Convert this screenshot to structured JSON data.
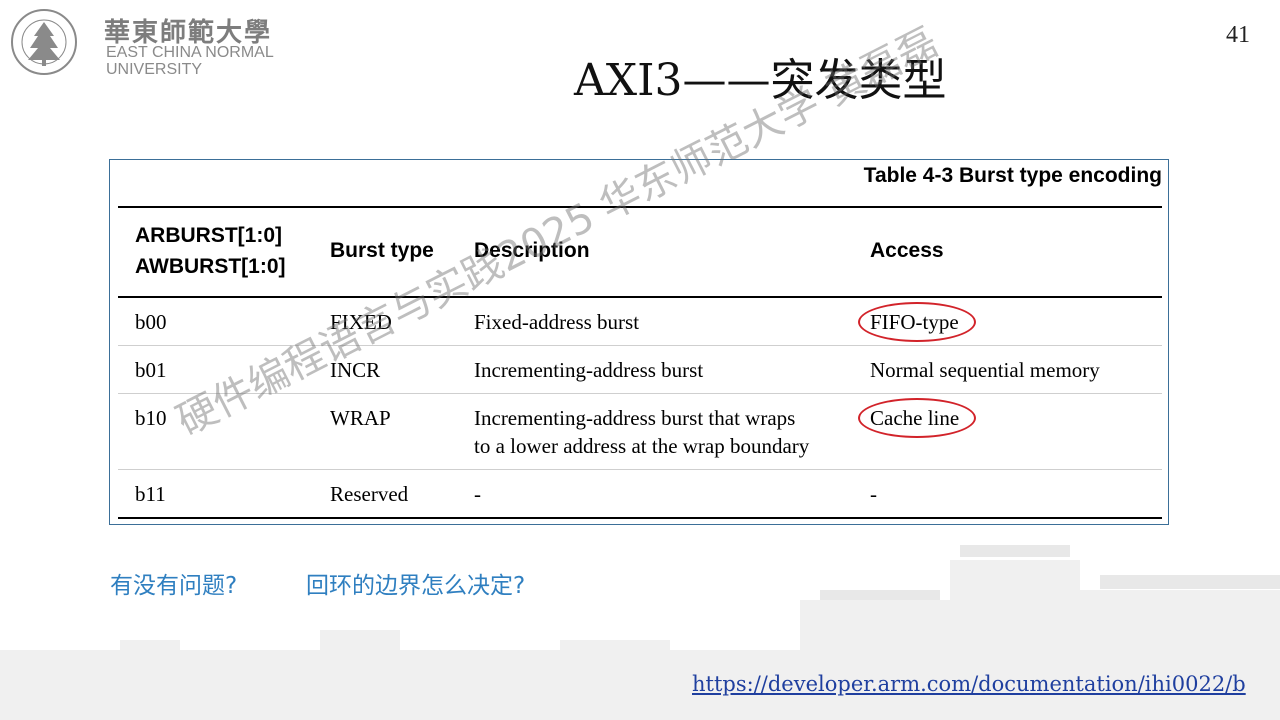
{
  "header": {
    "logo_cn": "華東師範大學",
    "logo_en_line1": "EAST CHINA NORMAL",
    "logo_en_line2": "UNIVERSITY",
    "page_number": "41"
  },
  "title": "AXI3——突发类型",
  "table": {
    "caption": "Table 4-3 Burst type encoding",
    "headers": {
      "encoding_line1": "ARBURST[1:0]",
      "encoding_line2": "AWBURST[1:0]",
      "burst_type": "Burst type",
      "description": "Description",
      "access": "Access"
    },
    "rows": [
      {
        "encoding": "b00",
        "burst_type": "FIXED",
        "description_line1": "Fixed-address burst",
        "description_line2": "",
        "access": "FIFO-type"
      },
      {
        "encoding": "b01",
        "burst_type": "INCR",
        "description_line1": "Incrementing-address burst",
        "description_line2": "",
        "access": "Normal sequential memory"
      },
      {
        "encoding": "b10",
        "burst_type": "WRAP",
        "description_line1": "Incrementing-address burst that wraps",
        "description_line2": "to a lower address at the wrap boundary",
        "access": "Cache line"
      },
      {
        "encoding": "b11",
        "burst_type": "Reserved",
        "description_line1": "-",
        "description_line2": "",
        "access": "-"
      }
    ],
    "highlight_color": "#d2232a"
  },
  "questions": {
    "q1": "有没有问题?",
    "q2": "回环的边界怎么决定?"
  },
  "reference_url": "https://developer.arm.com/documentation/ihi0022/b",
  "watermark": "硬件编程语言与实践2025 华东师范大学 黄磊磊",
  "colors": {
    "question_text": "#2f7fc0",
    "link": "#1f3f9f",
    "table_border": "#3b6f98"
  }
}
